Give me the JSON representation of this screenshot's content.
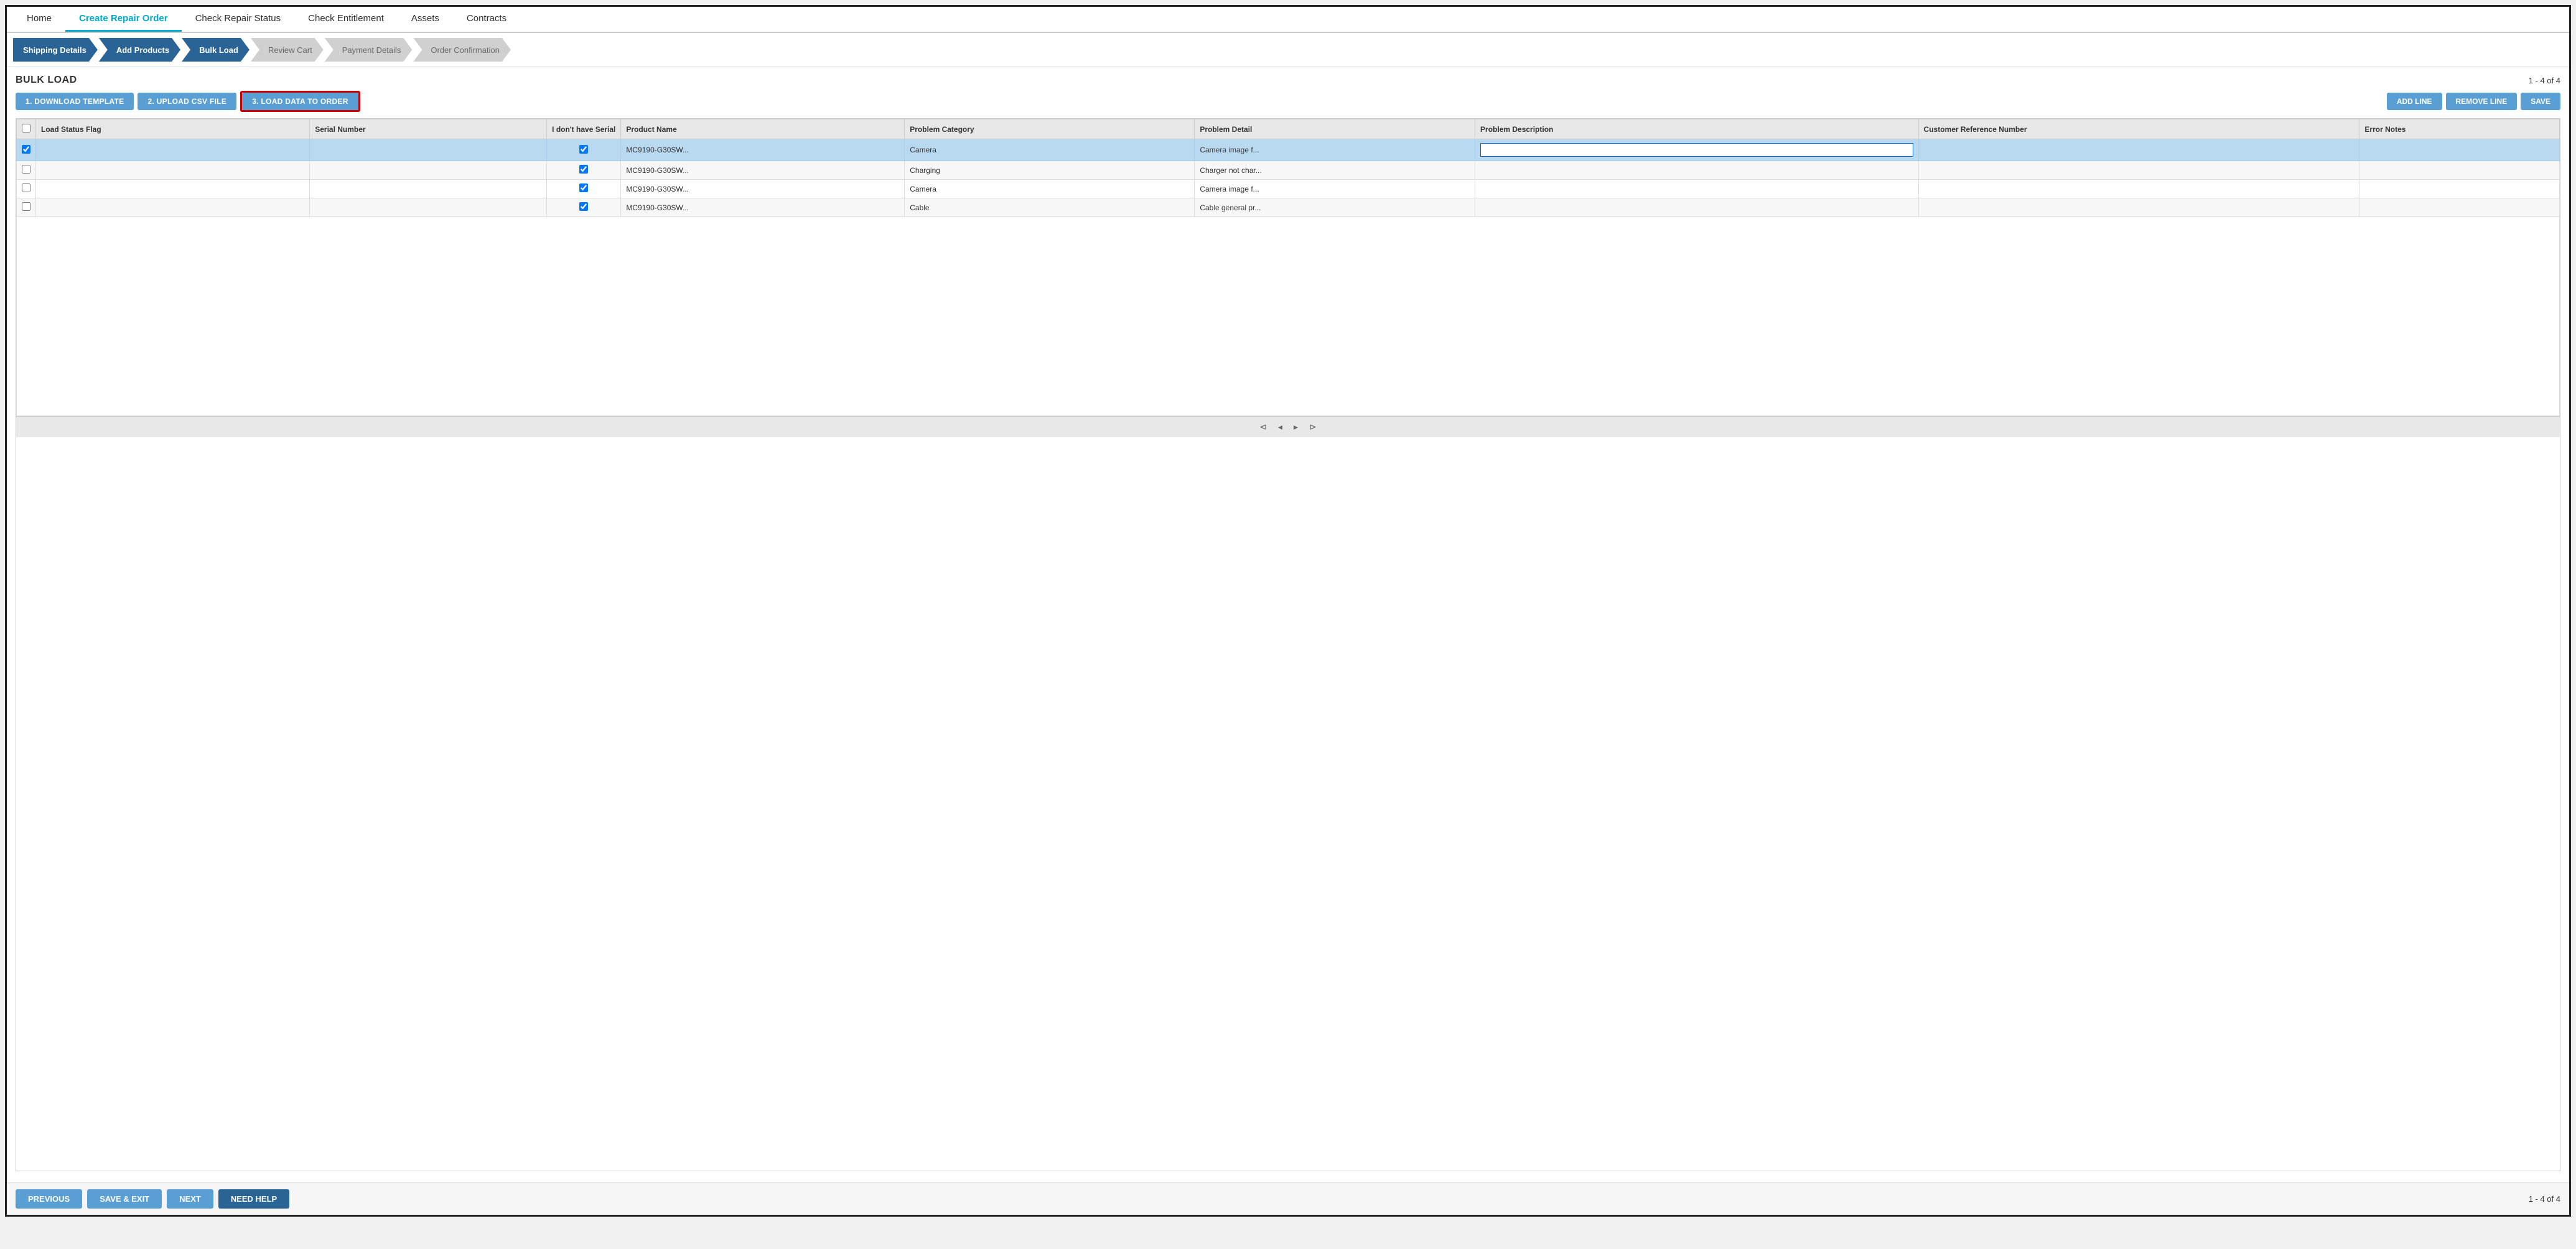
{
  "nav": {
    "items": [
      {
        "id": "home",
        "label": "Home",
        "active": false
      },
      {
        "id": "create-repair-order",
        "label": "Create Repair Order",
        "active": true
      },
      {
        "id": "check-repair-status",
        "label": "Check Repair Status",
        "active": false
      },
      {
        "id": "check-entitlement",
        "label": "Check Entitlement",
        "active": false
      },
      {
        "id": "assets",
        "label": "Assets",
        "active": false
      },
      {
        "id": "contracts",
        "label": "Contracts",
        "active": false
      }
    ]
  },
  "wizard": {
    "steps": [
      {
        "id": "shipping-details",
        "label": "Shipping Details",
        "active": true
      },
      {
        "id": "add-products",
        "label": "Add Products",
        "active": true
      },
      {
        "id": "bulk-load",
        "label": "Bulk Load",
        "active": true
      },
      {
        "id": "review-cart",
        "label": "Review Cart",
        "active": false
      },
      {
        "id": "payment-details",
        "label": "Payment Details",
        "active": false
      },
      {
        "id": "order-confirmation",
        "label": "Order Confirmation",
        "active": false
      }
    ]
  },
  "page": {
    "title": "BULK LOAD",
    "record_count_top": "1 - 4 of 4",
    "record_count_bottom": "1 - 4 of 4"
  },
  "buttons": {
    "download_template": "1. DOWNLOAD TEMPLATE",
    "upload_csv": "2. UPLOAD CSV FILE",
    "load_data": "3. LOAD DATA TO ORDER",
    "add_line": "ADD LINE",
    "remove_line": "REMOVE LINE",
    "save": "SAVE",
    "previous": "PREVIOUS",
    "save_exit": "SAVE & EXIT",
    "next": "NEXT",
    "need_help": "NEED HELP"
  },
  "table": {
    "headers": [
      "Load Status Flag",
      "Serial Number",
      "I don't have Serial",
      "Product Name",
      "Problem Category",
      "Problem Detail",
      "Problem Description",
      "Customer Reference Number",
      "Error Notes"
    ],
    "rows": [
      {
        "selected": true,
        "load_status": "",
        "serial_number": "",
        "no_serial": true,
        "product_name": "MC9190-G30SW...",
        "problem_category": "Camera",
        "problem_detail": "Camera image f...",
        "problem_description": "",
        "customer_ref": "",
        "error_notes": "",
        "editing_desc": true
      },
      {
        "selected": false,
        "load_status": "",
        "serial_number": "",
        "no_serial": true,
        "product_name": "MC9190-G30SW...",
        "problem_category": "Charging",
        "problem_detail": "Charger not char...",
        "problem_description": "",
        "customer_ref": "",
        "error_notes": "",
        "editing_desc": false
      },
      {
        "selected": false,
        "load_status": "",
        "serial_number": "",
        "no_serial": true,
        "product_name": "MC9190-G30SW...",
        "problem_category": "Camera",
        "problem_detail": "Camera image f...",
        "problem_description": "",
        "customer_ref": "",
        "error_notes": "",
        "editing_desc": false
      },
      {
        "selected": false,
        "load_status": "",
        "serial_number": "",
        "no_serial": true,
        "product_name": "MC9190-G30SW...",
        "problem_category": "Cable",
        "problem_detail": "Cable general pr...",
        "problem_description": "",
        "customer_ref": "",
        "error_notes": "",
        "editing_desc": false
      }
    ]
  },
  "pagination": {
    "first": "⊲",
    "prev": "◂",
    "next": "▸",
    "last": "⊳"
  }
}
